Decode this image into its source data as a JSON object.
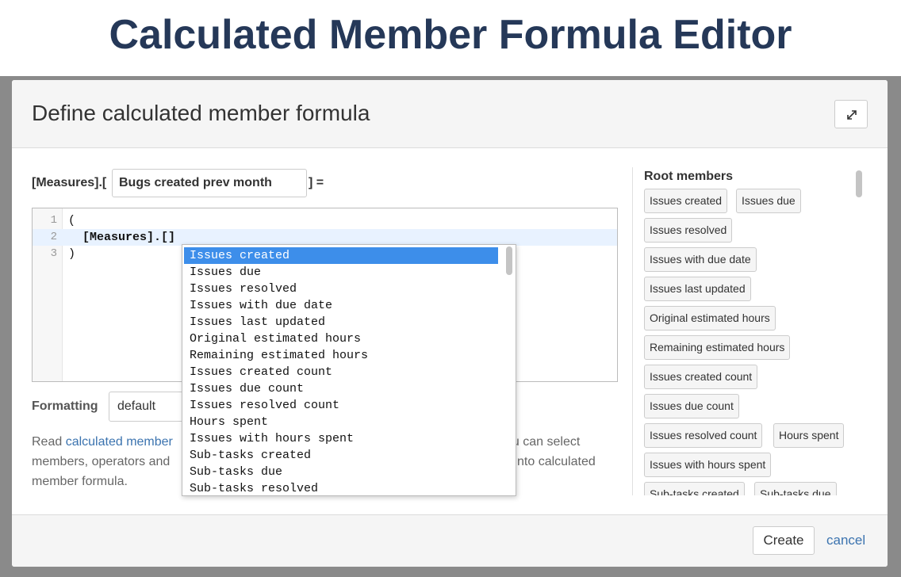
{
  "headline": "Calculated Member Formula Editor",
  "dialog": {
    "title": "Define calculated member formula",
    "expand_icon": "expand-icon"
  },
  "member_name": {
    "prefix": "[Measures].[",
    "value": "Bugs created prev month",
    "suffix": "] ="
  },
  "editor": {
    "lines": [
      {
        "number": "1",
        "text": "("
      },
      {
        "number": "2",
        "text": "  [Measures].[]"
      },
      {
        "number": "3",
        "text": ")"
      }
    ]
  },
  "autocomplete": {
    "selected_index": 0,
    "items": [
      "Issues created",
      "Issues due",
      "Issues resolved",
      "Issues with due date",
      "Issues last updated",
      "Original estimated hours",
      "Remaining estimated hours",
      "Issues created count",
      "Issues due count",
      "Issues resolved count",
      "Hours spent",
      "Issues with hours spent",
      "Sub-tasks created",
      "Sub-tasks due",
      "Sub-tasks resolved"
    ]
  },
  "formatting": {
    "label": "Formatting",
    "value": "default"
  },
  "help": {
    "line1_prefix": "Read ",
    "line1_link": "calculated member",
    "line1_right": "ou can select",
    "line2_left": "members, operators and",
    "line2_right": "nto calculated",
    "line3": "member formula."
  },
  "root_members": {
    "title": "Root members",
    "items": [
      "Issues created",
      "Issues due",
      "Issues resolved",
      "Issues with due date",
      "Issues last updated",
      "Original estimated hours",
      "Remaining estimated hours",
      "Issues created count",
      "Issues due count",
      "Issues resolved count",
      "Hours spent",
      "Issues with hours spent",
      "Sub-tasks created",
      "Sub-tasks due"
    ]
  },
  "footer": {
    "create_label": "Create",
    "cancel_label": "cancel"
  },
  "colors": {
    "headline": "#253858",
    "selection": "#3d8eea",
    "link": "#3b73af"
  }
}
